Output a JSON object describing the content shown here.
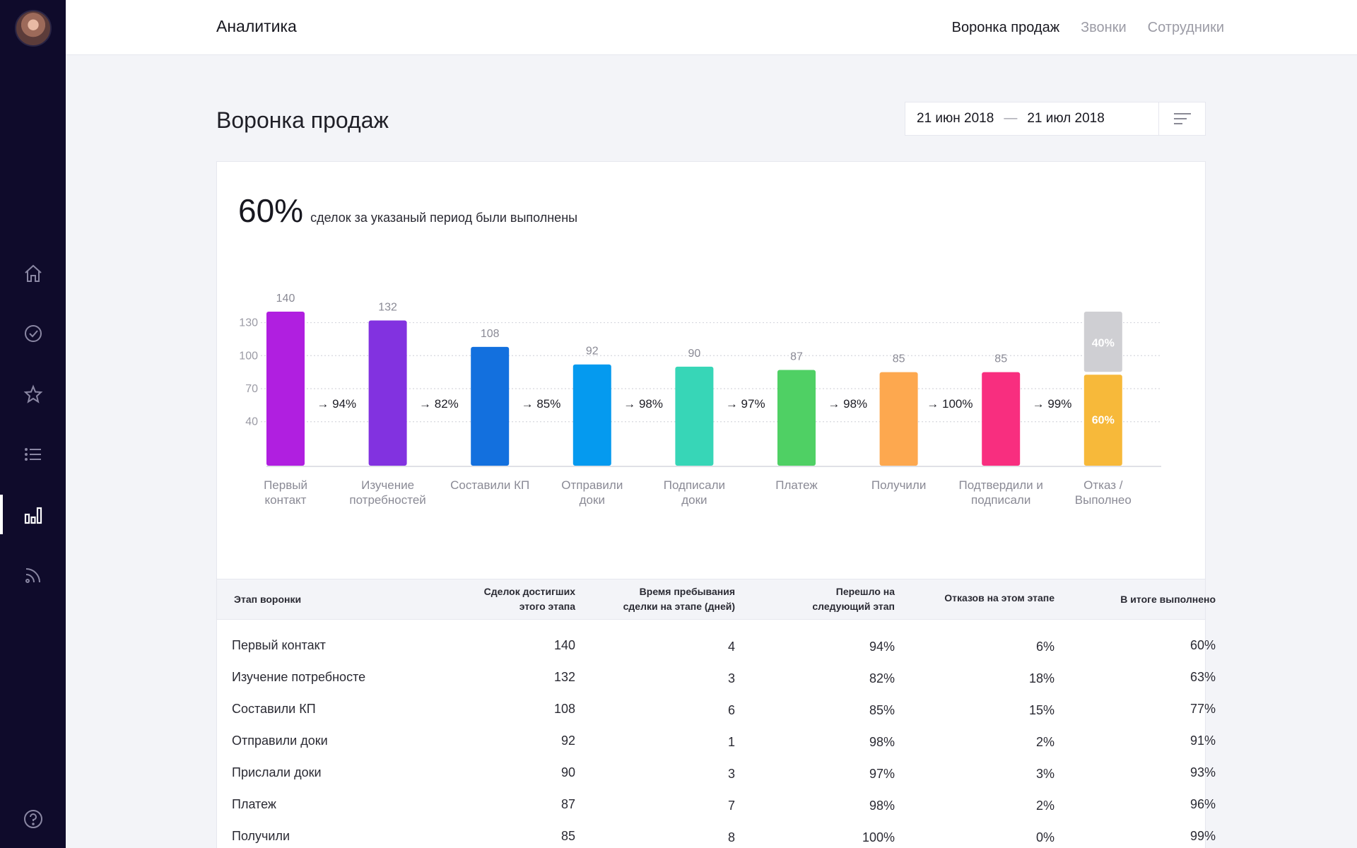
{
  "sidebar": {
    "icons": [
      "home-icon",
      "check-circle-icon",
      "star-icon",
      "list-icon",
      "bar-chart-icon",
      "rss-icon",
      "help-icon"
    ]
  },
  "header": {
    "title": "Аналитика",
    "nav": [
      "Воронка продаж",
      "Звонки",
      "Сотрудники"
    ]
  },
  "page": {
    "title": "Воронка продаж",
    "date_from": "21 июн 2018",
    "date_sep": "—",
    "date_to": "21 июл 2018"
  },
  "summary": {
    "percent": "60%",
    "text": "сделок за указаный период были выполнены"
  },
  "colors": {
    "bars": [
      "#b01fe0",
      "#8232e0",
      "#1370de",
      "#059aef",
      "#37d6b7",
      "#4fd064",
      "#fda84f",
      "#f82e7f"
    ],
    "final_top": "#cfcfd3",
    "final_bottom": "#f7b93a"
  },
  "chart_data": {
    "type": "bar",
    "categories": [
      "Первый контакт",
      "Изучение потребностей",
      "Составили КП",
      "Отправили доки",
      "Подписали доки",
      "Платеж",
      "Получили",
      "Подтвердили и подписали",
      "Отказ / Выполнео"
    ],
    "category_lines": [
      [
        "Первый",
        "контакт"
      ],
      [
        "Изучение",
        "потребностей"
      ],
      [
        "Составили КП"
      ],
      [
        "Отправили",
        "доки"
      ],
      [
        "Подписали",
        "доки"
      ],
      [
        "Платеж"
      ],
      [
        "Получили"
      ],
      [
        "Подтвердили и",
        "подписали"
      ],
      [
        "Отказ /",
        "Выполнео"
      ]
    ],
    "values": [
      140,
      132,
      108,
      92,
      90,
      87,
      85,
      85
    ],
    "conversions": [
      "→ 94%",
      "→ 82%",
      "→ 85%",
      "→ 98%",
      "→ 97%",
      "→ 98%",
      "→ 100%",
      "→ 99%"
    ],
    "final_split": {
      "fail_label": "40%",
      "done_label": "60%",
      "fail": 40,
      "done": 60
    },
    "yticks": [
      40,
      70,
      100,
      130
    ],
    "ylim": [
      0,
      150
    ],
    "grid": true
  },
  "table": {
    "headers": [
      [
        "Этап воронки"
      ],
      [
        "Сделок достигших",
        "этого этапа"
      ],
      [
        "Время пребывания",
        "сделки на этапе (дней)"
      ],
      [
        "Перешло на",
        "следующий этап"
      ],
      [
        "Отказов на этом этапе"
      ],
      [
        "В итоге выполнено"
      ]
    ],
    "rows": [
      [
        "Первый контакт",
        "140",
        "4",
        "94%",
        "6%",
        "60%"
      ],
      [
        "Изучение потребносте",
        "132",
        "3",
        "82%",
        "18%",
        "63%"
      ],
      [
        "Составили КП",
        "108",
        "6",
        "85%",
        "15%",
        "77%"
      ],
      [
        "Отправили доки",
        "92",
        "1",
        "98%",
        "2%",
        "91%"
      ],
      [
        "Прислали доки",
        "90",
        "3",
        "97%",
        "3%",
        "93%"
      ],
      [
        "Платеж",
        "87",
        "7",
        "98%",
        "2%",
        "96%"
      ],
      [
        "Получили",
        "85",
        "8",
        "100%",
        "0%",
        "99%"
      ]
    ]
  }
}
